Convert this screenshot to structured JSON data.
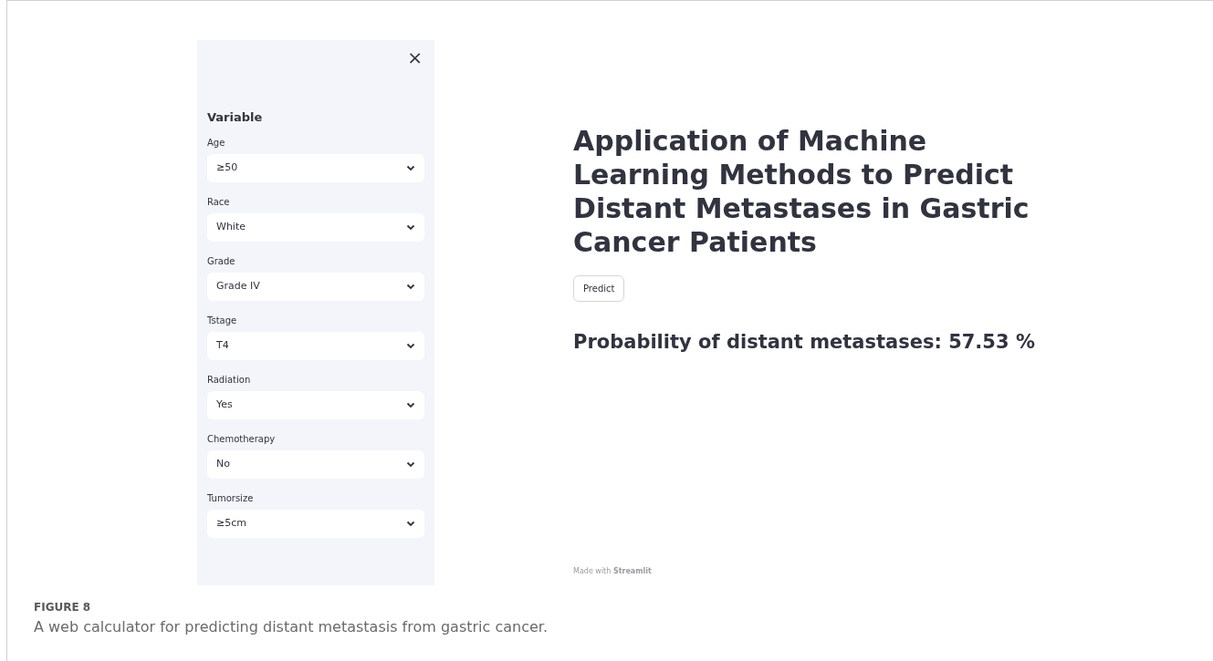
{
  "sidebar": {
    "close": "×",
    "heading": "Variable",
    "fields": [
      {
        "label": "Age",
        "value": "≥50"
      },
      {
        "label": "Race",
        "value": "White"
      },
      {
        "label": "Grade",
        "value": "Grade IV"
      },
      {
        "label": "Tstage",
        "value": "T4"
      },
      {
        "label": "Radiation",
        "value": "Yes"
      },
      {
        "label": "Chemotherapy",
        "value": "No"
      },
      {
        "label": "Tumorsize",
        "value": "≥5cm"
      }
    ]
  },
  "main": {
    "title": "Application of Machine Learning Methods to Predict Distant Metastases in Gastric Cancer Patients",
    "button": "Predict",
    "result": "Probability of distant metastases: 57.53 %",
    "footer": "Made with **Streamlit**"
  },
  "caption": {
    "label": "FIGURE 8",
    "text": "A web calculator for predicting distant metastasis from gastric cancer."
  }
}
